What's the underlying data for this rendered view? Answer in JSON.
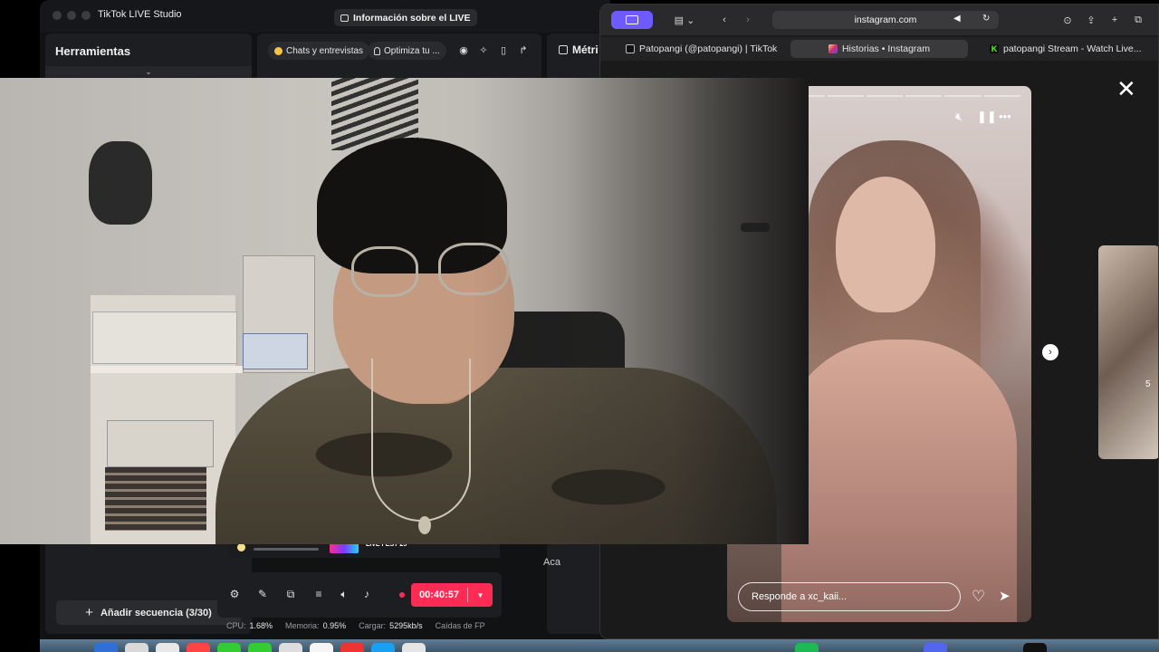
{
  "tiktok": {
    "window_title": "TikTok LIVE Studio",
    "live_info_label": "Información sobre el LIVE",
    "tools_title": "Herramientas",
    "add_sequence_label": "Añadir secuencia (3/30)",
    "chip_chats": "Chats y entrevistas",
    "chip_optimize": "Optimiza tu ...",
    "metrics_title": "Métri",
    "aca_text": "Aca",
    "timer": "00:40:57",
    "stats": {
      "cpu_label": "CPU:",
      "cpu_value": "1.68%",
      "memory_label": "Memoria:",
      "memory_value": "0.95%",
      "upload_label": "Cargar:",
      "upload_value": "5295kb/s",
      "drops_label": "Caídas de FP"
    },
    "strip_label": "LIVE FEST 25"
  },
  "safari": {
    "url": "instagram.com",
    "tabs": [
      {
        "label": "Patopangi (@patopangi) | TikTok",
        "favicon": "tiktok-icon"
      },
      {
        "label": "Historias • Instagram",
        "favicon": "instagram-icon",
        "active": true
      },
      {
        "label": "patopangi Stream - Watch Live...",
        "favicon": "kick-icon"
      }
    ],
    "reply_placeholder": "Responde a xc_kaii...",
    "side_number": "5"
  },
  "colors": {
    "tiktok_red": "#fe2c55",
    "safari_accent": "#6e5bff",
    "panel_bg": "#1d1e21"
  }
}
